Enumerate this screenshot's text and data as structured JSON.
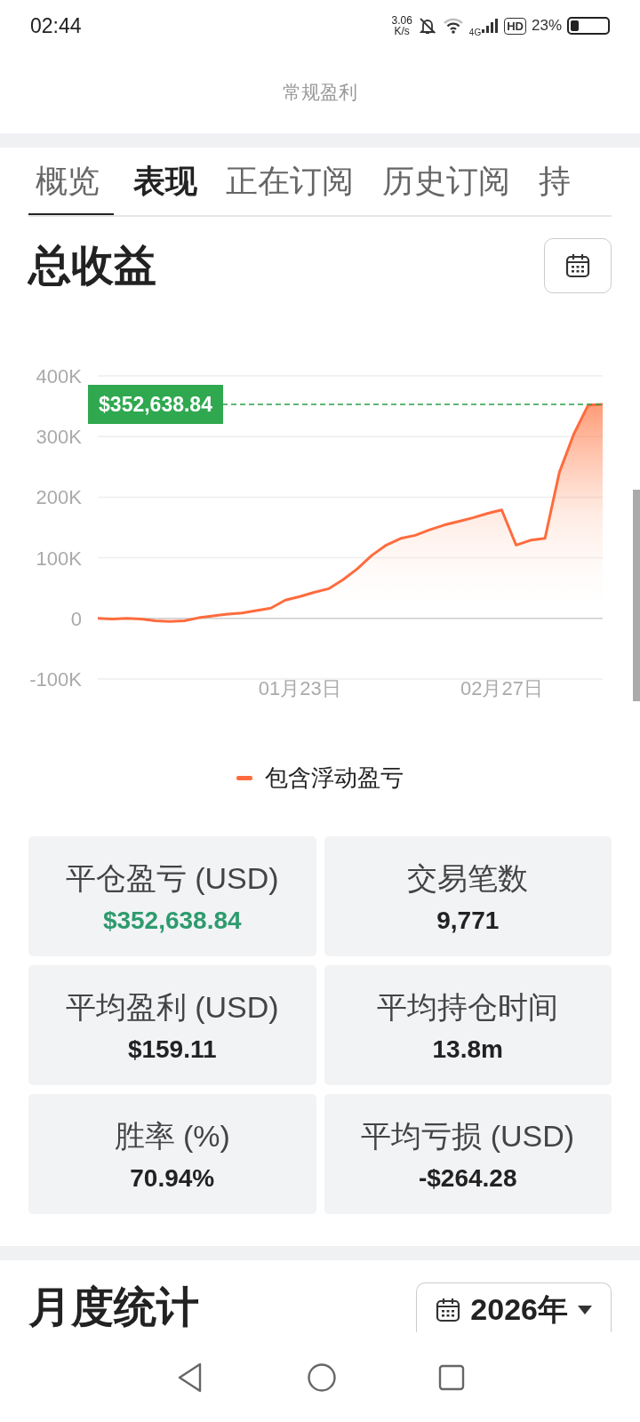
{
  "status_bar": {
    "time": "02:44",
    "speed_value": "3.06",
    "speed_unit": "K/s",
    "network": "4G",
    "hd": "HD",
    "battery": "23%"
  },
  "page_title": "常规盈利",
  "tabs": [
    {
      "label": "概览",
      "selected": true,
      "highlighted": false
    },
    {
      "label": "表现",
      "selected": false,
      "highlighted": true
    },
    {
      "label": "正在订阅",
      "selected": false,
      "highlighted": false
    },
    {
      "label": "历史订阅",
      "selected": false,
      "highlighted": false
    },
    {
      "label": "持",
      "selected": false,
      "highlighted": false
    }
  ],
  "total_section": {
    "title": "总收益",
    "chart_data": {
      "type": "area",
      "categories": [
        null,
        null,
        null,
        null,
        null,
        null,
        null,
        null,
        null,
        null,
        null,
        null,
        null,
        null,
        "01月23日",
        null,
        null,
        null,
        null,
        null,
        null,
        null,
        null,
        null,
        null,
        null,
        null,
        null,
        "02月27日",
        null,
        null,
        null,
        null,
        null,
        null,
        null
      ],
      "series": [
        {
          "name": "包含浮动盈亏",
          "color": "#ff6b3d",
          "values": [
            0,
            -1,
            0,
            -1,
            -4,
            -5,
            -4,
            1,
            4,
            7,
            9,
            13,
            17,
            30,
            36,
            43,
            49,
            64,
            82,
            104,
            121,
            132,
            137,
            146,
            154,
            160,
            166,
            173,
            179,
            121,
            129,
            132,
            241,
            304,
            352,
            353
          ]
        }
      ],
      "ylim": [
        -100,
        400
      ],
      "grid": true,
      "yticks": [
        {
          "value": 400,
          "label": "400K"
        },
        {
          "value": 300,
          "label": "300K"
        },
        {
          "value": 200,
          "label": "200K"
        },
        {
          "value": 100,
          "label": "100K"
        },
        {
          "value": 0,
          "label": "0"
        },
        {
          "value": -100,
          "label": "-100K"
        }
      ],
      "annotations": [
        "$352,638.84"
      ]
    }
  },
  "stats": [
    {
      "label": "平仓盈亏 (USD)",
      "value": "$352,638.84",
      "positive": true
    },
    {
      "label": "交易笔数",
      "value": "9,771",
      "positive": false
    },
    {
      "label": "平均盈利 (USD)",
      "value": "$159.11",
      "positive": false
    },
    {
      "label": "平均持仓时间",
      "value": "13.8m",
      "positive": false
    },
    {
      "label": "胜率 (%)",
      "value": "70.94%",
      "positive": false
    },
    {
      "label": "平均亏损 (USD)",
      "value": "-$264.28",
      "positive": false
    }
  ],
  "monthly_section": {
    "title": "月度统计",
    "year": "2026年"
  }
}
